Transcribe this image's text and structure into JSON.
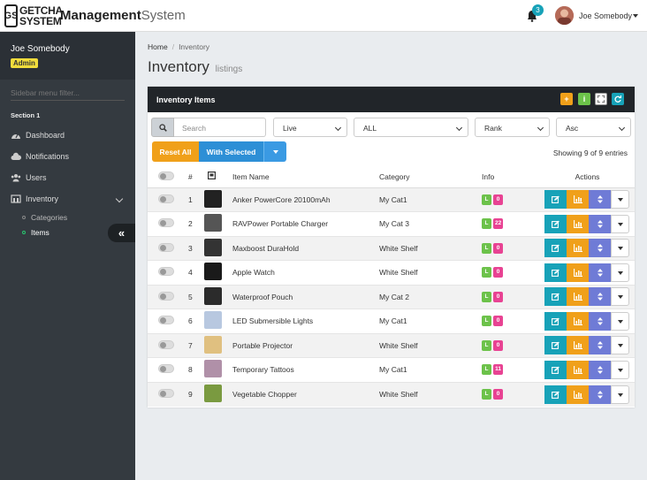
{
  "brand": {
    "logo_mark": "GS",
    "logo_text_1": "GETCHA",
    "logo_text_2": "SYSTEM",
    "title_bold": "Management",
    "title_rest": "System"
  },
  "topbar": {
    "notification_count": "3",
    "user_name": "Joe Somebody"
  },
  "sidebar": {
    "user_name": "Joe Somebody",
    "user_role": "Admin",
    "filter_placeholder": "Sidebar menu filter...",
    "section": "Section 1",
    "items": [
      {
        "label": "Dashboard",
        "icon": "dashboard-icon"
      },
      {
        "label": "Notifications",
        "icon": "cloud-icon"
      },
      {
        "label": "Users",
        "icon": "users-icon"
      },
      {
        "label": "Inventory",
        "icon": "inventory-icon"
      }
    ],
    "sub_items": [
      {
        "label": "Categories"
      },
      {
        "label": "Items"
      }
    ],
    "collapse_label": "«"
  },
  "breadcrumb": {
    "home": "Home",
    "separator": "/",
    "current": "Inventory"
  },
  "page": {
    "title": "Inventory",
    "subtitle": "listings"
  },
  "card": {
    "title": "Inventory Items",
    "search_placeholder": "Search",
    "filter_status": "Live",
    "filter_category": "ALL",
    "filter_sort": "Rank",
    "filter_order": "Asc",
    "reset_label": "Reset All",
    "with_selected_label": "With Selected",
    "showing_text": "Showing 9 of 9 entries"
  },
  "table": {
    "headers": {
      "num": "#",
      "name": "Item Name",
      "category": "Category",
      "info": "Info",
      "actions": "Actions"
    },
    "rows": [
      {
        "num": "1",
        "name": "Anker PowerCore 20100mAh",
        "category": "My Cat1",
        "l": "L",
        "count": "0",
        "thumb": "#222"
      },
      {
        "num": "2",
        "name": "RAVPower Portable Charger",
        "category": "My Cat 3",
        "l": "L",
        "count": "22",
        "thumb": "#555"
      },
      {
        "num": "3",
        "name": "Maxboost DuraHold",
        "category": "White Shelf",
        "l": "L",
        "count": "0",
        "thumb": "#333"
      },
      {
        "num": "4",
        "name": "Apple Watch",
        "category": "White Shelf",
        "l": "L",
        "count": "0",
        "thumb": "#1a1a1a"
      },
      {
        "num": "5",
        "name": "Waterproof Pouch",
        "category": "My Cat 2",
        "l": "L",
        "count": "0",
        "thumb": "#2b2b2b"
      },
      {
        "num": "6",
        "name": "LED Submersible Lights",
        "category": "My Cat1",
        "l": "L",
        "count": "0",
        "thumb": "#b8c8e0"
      },
      {
        "num": "7",
        "name": "Portable Projector",
        "category": "White Shelf",
        "l": "L",
        "count": "0",
        "thumb": "#e0c080"
      },
      {
        "num": "8",
        "name": "Temporary Tattoos",
        "category": "My Cat1",
        "l": "L",
        "count": "11",
        "thumb": "#b090a8"
      },
      {
        "num": "9",
        "name": "Vegetable Chopper",
        "category": "White Shelf",
        "l": "L",
        "count": "0",
        "thumb": "#7a9a40"
      }
    ]
  },
  "colors": {
    "sidebar": "#343a40",
    "accent_teal": "#17a2b8",
    "accent_orange": "#f0a01a",
    "accent_blue": "#2d8fd6",
    "accent_purple": "#6f7bd6",
    "label_green": "#6cc24a",
    "label_pink": "#e84393"
  }
}
